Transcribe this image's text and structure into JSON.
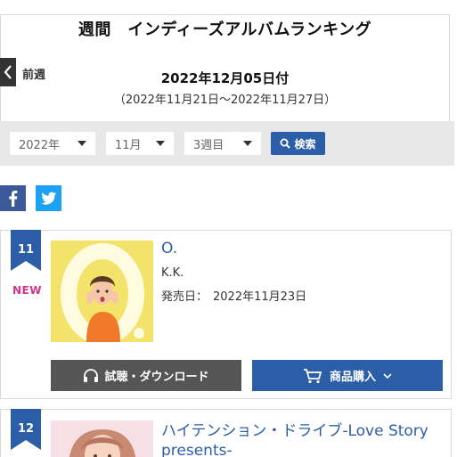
{
  "header": {
    "title": "週間　インディーズアルバムランキング",
    "prev_label": "前週",
    "issue_date": "2022年12月05日付",
    "period": "（2022年11月21日〜2022年11月27日）"
  },
  "filters": {
    "year": "2022年",
    "month": "11月",
    "week": "3週目",
    "search_label": "検索"
  },
  "colors": {
    "accent": "#2c5ea8",
    "new_badge": "#d6338a",
    "facebook": "#3b5998",
    "twitter": "#1da1f2"
  },
  "rankings": [
    {
      "rank": "11",
      "badge": "NEW",
      "title": "O.",
      "artist": "K.K.",
      "release_label": "発売日：",
      "release_date": "2022年11月23日",
      "listen_label": "試聴・ダウンロード",
      "buy_label": "商品購入"
    },
    {
      "rank": "12",
      "title": "ハイテンション・ドライブ-Love Story presents-"
    }
  ]
}
